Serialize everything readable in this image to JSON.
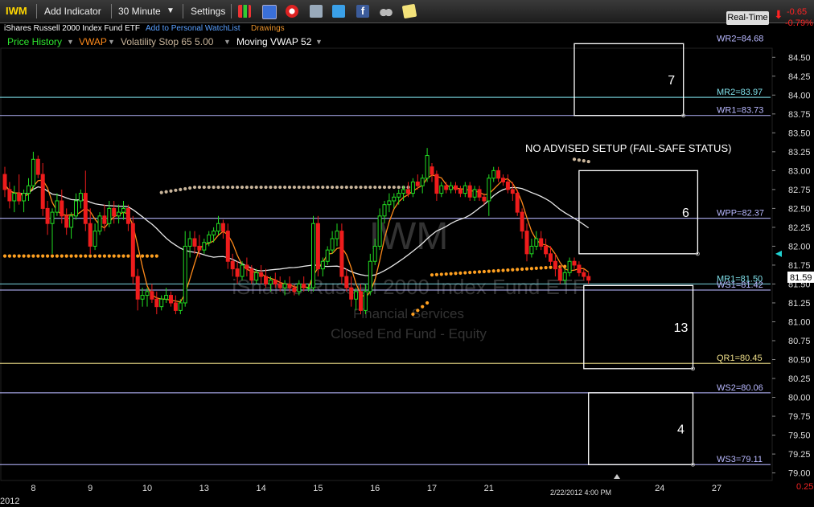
{
  "toolbar": {
    "symbol": "IWM",
    "add_indicator": "Add Indicator",
    "interval": "30 Minute",
    "settings": "Settings",
    "icons": [
      "bar-chart-icon",
      "candle-icon",
      "save-icon",
      "alarm-icon",
      "news-icon",
      "twitter-icon",
      "facebook-icon",
      "binoculars-icon",
      "notes-icon"
    ],
    "realtime": "Real-Time",
    "change": "-0.65",
    "change_pct": "-0.79%"
  },
  "header": {
    "name": "iShares Russell 2000 Index Fund ETF",
    "watchlist_link": "Add to Personal WatchList",
    "drawings": "Drawings"
  },
  "studies": [
    {
      "label": "Price History",
      "color": "#2ee62e"
    },
    {
      "label": "VWAP",
      "color": "#ff8a1a"
    },
    {
      "label": "Volatility Stop 65 5.00",
      "color": "#c8b49a"
    },
    {
      "label": "Moving VWAP 52",
      "color": "#ffffff"
    }
  ],
  "watermark": {
    "symbol": "IWM",
    "name": "iShares Russell 2000 Index Fund ETF",
    "sector": "Financial Services",
    "type": "Closed End Fund - Equity"
  },
  "chart_data": {
    "type": "candlestick",
    "ylim": [
      78.9,
      84.62
    ],
    "y_ticks": [
      79.0,
      79.25,
      79.5,
      79.75,
      80.0,
      80.25,
      80.5,
      80.75,
      81.0,
      81.25,
      81.5,
      81.75,
      82.0,
      82.25,
      82.5,
      82.75,
      83.0,
      83.25,
      83.5,
      83.75,
      84.0,
      84.25,
      84.5
    ],
    "y_tick_labels": [
      "79.00",
      "79.25",
      "79.50",
      "79.75",
      "80.00",
      "80.25",
      "80.50",
      "80.75",
      "81.00",
      "81.25",
      "81.50",
      "81.75",
      "82.00",
      "82.25",
      "82.50",
      "82.75",
      "83.00",
      "83.25",
      "83.50",
      "83.75",
      "84.00",
      "84.25",
      "84.50"
    ],
    "x_labels": [
      "8",
      "9",
      "10",
      "13",
      "14",
      "15",
      "16",
      "17",
      "21",
      "24",
      "27"
    ],
    "x_label_bars": [
      6,
      18,
      30,
      42,
      54,
      66,
      78,
      90,
      102,
      138,
      150
    ],
    "year_label": "2012",
    "cursor_label": "2/22/2012 4:00 PM",
    "current_price": "81.59",
    "bottom_right_value": "0.25",
    "annotation": "NO ADVISED SETUP (FAIL-SAFE STATUS)",
    "levels": [
      {
        "label": "WR2=84.68",
        "value": 84.68,
        "color": "#b8b8ff",
        "line": false
      },
      {
        "label": "MR2=83.97",
        "value": 83.97,
        "color": "#7fe0ea",
        "line": true
      },
      {
        "label": "WR1=83.73",
        "value": 83.73,
        "color": "#b8b8ff",
        "line": true
      },
      {
        "label": "WPP=82.37",
        "value": 82.37,
        "color": "#b8b8ff",
        "line": true
      },
      {
        "label": "MR1=81.50",
        "value": 81.5,
        "color": "#7fe0ea",
        "line": true
      },
      {
        "label": "WS1=81.42",
        "value": 81.42,
        "color": "#b8b8ff",
        "line": true
      },
      {
        "label": "QR1=80.45",
        "value": 80.45,
        "color": "#f0e08a",
        "line": true
      },
      {
        "label": "WS2=80.06",
        "value": 80.06,
        "color": "#b8b8ff",
        "line": true
      },
      {
        "label": "WS3=79.11",
        "value": 79.11,
        "color": "#b8b8ff",
        "line": true
      }
    ],
    "boxes": [
      {
        "label": "7",
        "bar_start": 120,
        "bar_end": 143,
        "top": 84.68,
        "bottom": 83.73
      },
      {
        "label": "6",
        "bar_start": 121,
        "bar_end": 146,
        "top": 83.0,
        "bottom": 81.9
      },
      {
        "label": "13",
        "bar_start": 122,
        "bar_end": 145,
        "top": 81.48,
        "bottom": 80.38
      },
      {
        "label": "4",
        "bar_start": 123,
        "bar_end": 145,
        "top": 80.06,
        "bottom": 79.11
      }
    ],
    "candles": [
      [
        82.95,
        83.05,
        82.65,
        82.75
      ],
      [
        82.75,
        82.85,
        82.5,
        82.6
      ],
      [
        82.6,
        82.8,
        82.45,
        82.7
      ],
      [
        82.7,
        82.95,
        82.55,
        82.6
      ],
      [
        82.6,
        82.75,
        82.45,
        82.7
      ],
      [
        82.7,
        82.9,
        82.6,
        82.8
      ],
      [
        82.8,
        83.25,
        82.75,
        83.15
      ],
      [
        83.15,
        83.2,
        82.9,
        82.95
      ],
      [
        82.95,
        83.1,
        82.4,
        82.5
      ],
      [
        82.5,
        82.6,
        82.15,
        82.3
      ],
      [
        82.3,
        82.5,
        81.9,
        82.45
      ],
      [
        82.45,
        82.7,
        82.4,
        82.6
      ],
      [
        82.6,
        82.75,
        82.3,
        82.4
      ],
      [
        82.4,
        82.5,
        82.15,
        82.25
      ],
      [
        82.25,
        82.45,
        82.1,
        82.4
      ],
      [
        82.4,
        82.7,
        82.35,
        82.6
      ],
      [
        82.6,
        82.75,
        82.5,
        82.7
      ],
      [
        82.7,
        83.0,
        82.2,
        82.3
      ],
      [
        82.3,
        82.5,
        81.9,
        82.0
      ],
      [
        82.0,
        82.3,
        81.95,
        82.2
      ],
      [
        82.2,
        82.45,
        82.15,
        82.4
      ],
      [
        82.4,
        82.55,
        82.2,
        82.3
      ],
      [
        82.3,
        82.6,
        82.25,
        82.5
      ],
      [
        82.5,
        82.6,
        82.3,
        82.4
      ],
      [
        82.4,
        82.55,
        82.3,
        82.45
      ],
      [
        82.45,
        82.6,
        82.35,
        82.5
      ],
      [
        82.5,
        82.55,
        82.2,
        82.3
      ],
      [
        82.3,
        82.4,
        81.5,
        81.6
      ],
      [
        81.6,
        81.7,
        81.15,
        81.3
      ],
      [
        81.3,
        81.45,
        81.2,
        81.35
      ],
      [
        81.35,
        81.45,
        81.2,
        81.4
      ],
      [
        81.4,
        81.5,
        81.25,
        81.3
      ],
      [
        81.3,
        81.4,
        81.1,
        81.2
      ],
      [
        81.2,
        81.35,
        81.15,
        81.3
      ],
      [
        81.3,
        81.45,
        81.25,
        81.35
      ],
      [
        81.35,
        81.4,
        81.2,
        81.25
      ],
      [
        81.25,
        81.35,
        81.1,
        81.15
      ],
      [
        81.15,
        81.3,
        81.1,
        81.25
      ],
      [
        81.25,
        82.2,
        81.2,
        82.0
      ],
      [
        82.0,
        82.2,
        81.85,
        82.1
      ],
      [
        82.1,
        82.2,
        81.9,
        82.0
      ],
      [
        82.0,
        82.15,
        81.85,
        81.95
      ],
      [
        81.95,
        82.1,
        81.9,
        82.05
      ],
      [
        82.05,
        82.2,
        82.0,
        82.15
      ],
      [
        82.15,
        82.25,
        82.05,
        82.2
      ],
      [
        82.2,
        82.4,
        82.15,
        82.3
      ],
      [
        82.3,
        82.35,
        82.1,
        82.2
      ],
      [
        82.2,
        82.3,
        81.7,
        81.8
      ],
      [
        81.8,
        81.9,
        81.6,
        81.7
      ],
      [
        81.7,
        81.8,
        81.5,
        81.6
      ],
      [
        81.6,
        81.8,
        81.55,
        81.75
      ],
      [
        81.75,
        81.85,
        81.6,
        81.7
      ],
      [
        81.7,
        81.75,
        81.5,
        81.55
      ],
      [
        81.55,
        81.7,
        81.5,
        81.65
      ],
      [
        81.65,
        81.75,
        81.5,
        81.6
      ],
      [
        81.6,
        81.7,
        81.45,
        81.5
      ],
      [
        81.5,
        81.6,
        81.4,
        81.55
      ],
      [
        81.55,
        81.65,
        81.45,
        81.5
      ],
      [
        81.5,
        81.6,
        81.4,
        81.45
      ],
      [
        81.45,
        81.55,
        81.35,
        81.5
      ],
      [
        81.5,
        81.6,
        81.4,
        81.45
      ],
      [
        81.45,
        81.5,
        81.35,
        81.4
      ],
      [
        81.4,
        81.55,
        81.35,
        81.5
      ],
      [
        81.5,
        81.6,
        81.4,
        81.45
      ],
      [
        81.45,
        81.5,
        81.4,
        81.45
      ],
      [
        81.45,
        82.4,
        81.4,
        82.3
      ],
      [
        82.3,
        82.4,
        81.6,
        81.7
      ],
      [
        81.7,
        81.85,
        81.6,
        81.8
      ],
      [
        81.8,
        82.0,
        81.75,
        81.95
      ],
      [
        81.95,
        82.2,
        81.9,
        82.1
      ],
      [
        82.1,
        82.3,
        82.0,
        82.2
      ],
      [
        82.2,
        82.3,
        81.5,
        81.6
      ],
      [
        81.6,
        81.7,
        81.4,
        81.45
      ],
      [
        81.45,
        81.6,
        81.2,
        81.3
      ],
      [
        81.3,
        81.45,
        81.15,
        81.4
      ],
      [
        81.4,
        81.5,
        81.1,
        81.15
      ],
      [
        81.15,
        81.5,
        81.1,
        81.4
      ],
      [
        81.4,
        81.9,
        81.35,
        81.8
      ],
      [
        81.8,
        82.1,
        81.75,
        82.0
      ],
      [
        82.0,
        82.5,
        81.95,
        82.4
      ],
      [
        82.4,
        82.6,
        82.3,
        82.55
      ],
      [
        82.55,
        82.7,
        82.45,
        82.6
      ],
      [
        82.6,
        82.7,
        82.5,
        82.65
      ],
      [
        82.65,
        82.75,
        82.55,
        82.7
      ],
      [
        82.7,
        82.8,
        82.6,
        82.75
      ],
      [
        82.75,
        82.85,
        82.65,
        82.7
      ],
      [
        82.7,
        82.9,
        82.65,
        82.85
      ],
      [
        82.85,
        82.95,
        82.75,
        82.8
      ],
      [
        82.8,
        82.95,
        82.7,
        82.9
      ],
      [
        82.9,
        83.3,
        82.85,
        83.2
      ],
      [
        83.05,
        83.1,
        82.85,
        82.95
      ],
      [
        82.95,
        83.0,
        82.6,
        82.7
      ],
      [
        82.7,
        82.85,
        82.65,
        82.8
      ],
      [
        82.8,
        82.85,
        82.7,
        82.75
      ],
      [
        82.75,
        82.85,
        82.7,
        82.8
      ],
      [
        82.8,
        82.85,
        82.7,
        82.75
      ],
      [
        82.75,
        82.8,
        82.65,
        82.7
      ],
      [
        82.7,
        82.85,
        82.65,
        82.8
      ],
      [
        82.8,
        82.85,
        82.6,
        82.65
      ],
      [
        82.65,
        82.8,
        82.6,
        82.75
      ],
      [
        82.75,
        82.8,
        82.6,
        82.65
      ],
      [
        82.65,
        82.7,
        82.55,
        82.6
      ],
      [
        82.6,
        82.95,
        82.4,
        82.9
      ],
      [
        82.9,
        83.05,
        82.85,
        83.0
      ],
      [
        83.0,
        83.05,
        82.85,
        82.9
      ],
      [
        82.9,
        82.95,
        82.8,
        82.85
      ],
      [
        82.85,
        82.95,
        82.7,
        82.75
      ],
      [
        82.75,
        82.85,
        82.6,
        82.7
      ],
      [
        82.7,
        82.75,
        82.4,
        82.45
      ],
      [
        82.45,
        82.5,
        82.1,
        82.2
      ],
      [
        82.2,
        82.3,
        81.8,
        81.9
      ],
      [
        81.9,
        82.1,
        81.85,
        82.0
      ],
      [
        82.0,
        82.2,
        81.95,
        82.1
      ],
      [
        82.1,
        82.2,
        81.95,
        82.0
      ],
      [
        82.0,
        82.1,
        81.85,
        81.9
      ],
      [
        81.9,
        82.0,
        81.75,
        81.8
      ],
      [
        81.8,
        81.9,
        81.6,
        81.7
      ],
      [
        81.7,
        81.75,
        81.5,
        81.55
      ],
      [
        81.55,
        81.7,
        81.5,
        81.65
      ],
      [
        81.65,
        81.85,
        81.6,
        81.8
      ],
      [
        81.8,
        81.85,
        81.7,
        81.75
      ],
      [
        81.75,
        81.8,
        81.6,
        81.65
      ],
      [
        81.65,
        81.7,
        81.55,
        81.6
      ],
      [
        81.6,
        81.65,
        81.5,
        81.55
      ]
    ]
  }
}
